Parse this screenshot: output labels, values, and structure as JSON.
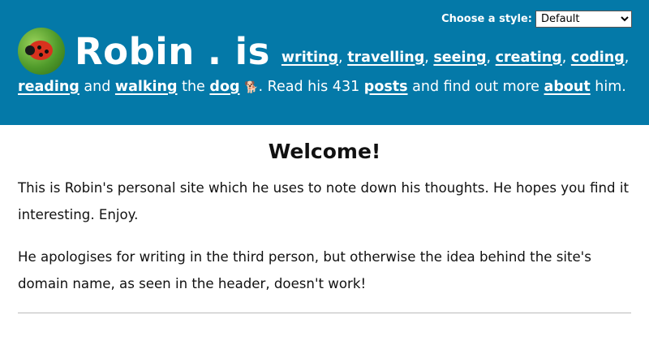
{
  "header": {
    "style_label": "Choose a style:",
    "style_selected": "Default",
    "site_title": "Robin . is",
    "links": {
      "writing": "writing",
      "travelling": "travelling",
      "seeing": "seeing",
      "creating": "creating",
      "coding": "coding",
      "reading": "reading",
      "walking": "walking",
      "dog": "dog",
      "posts": "posts",
      "about": "about"
    },
    "text": {
      "and": "and",
      "the": "the",
      "read_his": ". Read his 431",
      "find_out": "and find out more",
      "him": "him."
    },
    "dog_emoji": "🐕",
    "background_color": "#0479a8"
  },
  "main": {
    "heading": "Welcome!",
    "paragraphs": [
      "This is Robin's personal site which he uses to note down his thoughts. He hopes you find it interesting. Enjoy.",
      "He apologises for writing in the third person, but otherwise the idea behind the site's domain name, as seen in the header, doesn't work!"
    ]
  }
}
